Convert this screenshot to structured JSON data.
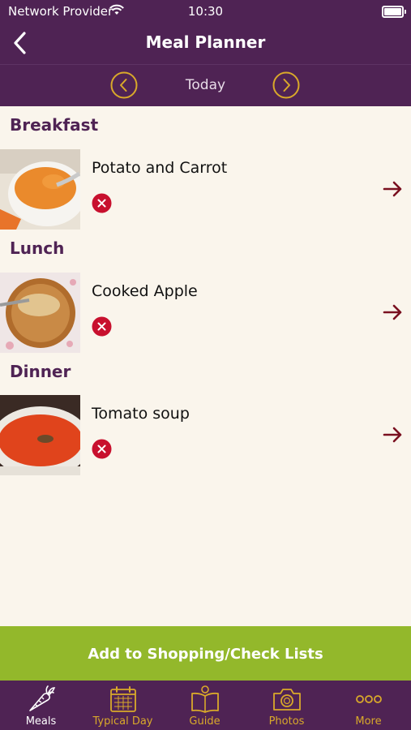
{
  "status": {
    "carrier": "Network Provider",
    "time": "10:30"
  },
  "nav": {
    "title": "Meal Planner",
    "back_icon": "chevron-left-icon"
  },
  "date": {
    "label": "Today",
    "prev_icon": "circle-chevron-left-icon",
    "next_icon": "circle-chevron-right-icon"
  },
  "meals": [
    {
      "section": "Breakfast",
      "name": "Potato and Carrot",
      "image": "carrot-puree-photo"
    },
    {
      "section": "Lunch",
      "name": "Cooked Apple",
      "image": "apple-puree-photo"
    },
    {
      "section": "Dinner",
      "name": "Tomato soup",
      "image": "tomato-soup-photo"
    }
  ],
  "cta": {
    "label": "Add to Shopping/Check Lists"
  },
  "tabs": [
    {
      "label": "Meals",
      "icon": "carrot-icon",
      "active": true
    },
    {
      "label": "Typical Day",
      "icon": "calendar-icon",
      "active": false
    },
    {
      "label": "Guide",
      "icon": "book-icon",
      "active": false
    },
    {
      "label": "Photos",
      "icon": "camera-icon",
      "active": false
    },
    {
      "label": "More",
      "icon": "more-dots-icon",
      "active": false
    }
  ],
  "colors": {
    "header": "#4f2354",
    "accent": "#d9a92a",
    "cta": "#93b82b",
    "remove": "#c8102e",
    "arrow": "#7a1020",
    "background": "#faf5ec"
  }
}
